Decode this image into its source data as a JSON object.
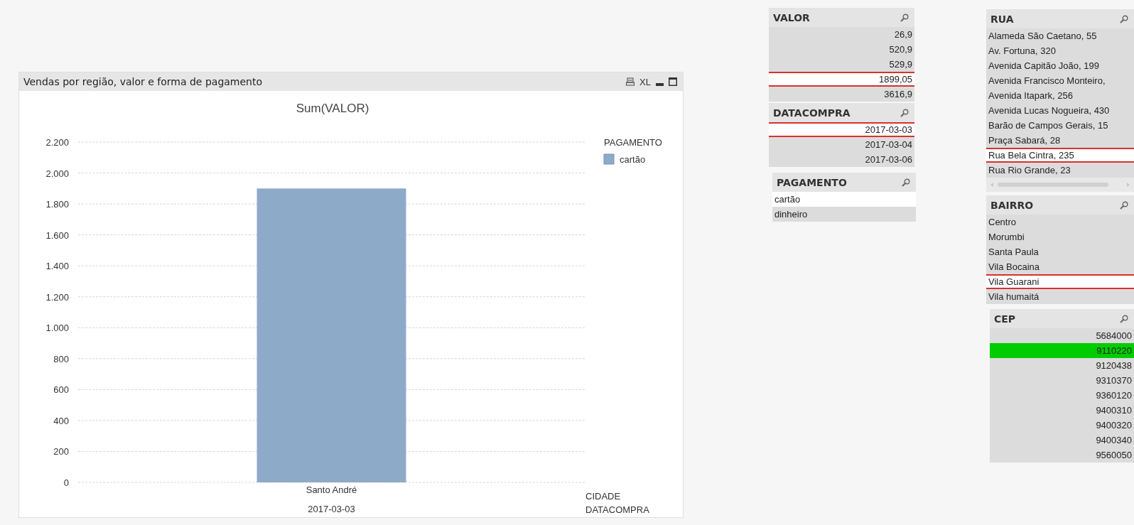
{
  "chart_panel": {
    "title": "Vendas por região, valor e forma de pagamento",
    "xl_label": "XL",
    "chart_data": {
      "type": "bar",
      "title": "Sum(VALOR)",
      "xlabel": "CIDADE",
      "categories": [
        "Santo André"
      ],
      "series": [
        {
          "name": "cartão",
          "color": "#8eaac9",
          "values": [
            1900
          ]
        }
      ],
      "grid": true,
      "ylim": [
        0,
        2200
      ],
      "yticks": [
        {
          "value": 0,
          "label": "0"
        },
        {
          "value": 200,
          "label": "200"
        },
        {
          "value": 400,
          "label": "400"
        },
        {
          "value": 600,
          "label": "600"
        },
        {
          "value": 800,
          "label": "800"
        },
        {
          "value": 1000,
          "label": "1.000"
        },
        {
          "value": 1200,
          "label": "1.200"
        },
        {
          "value": 1400,
          "label": "1.400"
        },
        {
          "value": 1600,
          "label": "1.600"
        },
        {
          "value": 1800,
          "label": "1.800"
        },
        {
          "value": 2000,
          "label": "2.000"
        },
        {
          "value": 2200,
          "label": "2.200"
        }
      ]
    },
    "legend_title": "PAGAMENTO",
    "second_dimension": {
      "label": "DATACOMPRA",
      "values": [
        "2017-03-03"
      ]
    }
  },
  "listboxes": [
    {
      "title": "VALOR",
      "kind": "numeric",
      "items": [
        {
          "text": "26,9",
          "selected": false,
          "possible": false,
          "outlined": false
        },
        {
          "text": "520,9",
          "selected": false,
          "possible": false,
          "outlined": false
        },
        {
          "text": "529,9",
          "selected": false,
          "possible": false,
          "outlined": false
        },
        {
          "text": "1899,05",
          "selected": false,
          "possible": true,
          "outlined": true
        },
        {
          "text": "3616,9",
          "selected": false,
          "possible": false,
          "outlined": false
        }
      ]
    },
    {
      "title": "DATACOMPRA",
      "kind": "numeric",
      "items": [
        {
          "text": "2017-03-03",
          "selected": false,
          "possible": true,
          "outlined": true
        },
        {
          "text": "2017-03-04",
          "selected": false,
          "possible": false,
          "outlined": false
        },
        {
          "text": "2017-03-06",
          "selected": false,
          "possible": false,
          "outlined": false
        }
      ]
    },
    {
      "title": "PAGAMENTO",
      "kind": "text",
      "items": [
        {
          "text": "cartão",
          "selected": false,
          "possible": true,
          "outlined": false
        },
        {
          "text": "dinheiro",
          "selected": false,
          "possible": false,
          "outlined": false
        }
      ]
    },
    {
      "title": "RUA",
      "kind": "text",
      "has_scrollbar": true,
      "items": [
        {
          "text": "Alameda São Caetano, 55",
          "selected": false,
          "possible": false,
          "outlined": false
        },
        {
          "text": "Av. Fortuna, 320",
          "selected": false,
          "possible": false,
          "outlined": false
        },
        {
          "text": "Avenida Capitão João, 199",
          "selected": false,
          "possible": false,
          "outlined": false
        },
        {
          "text": "Avenida Francisco Monteiro,",
          "selected": false,
          "possible": false,
          "outlined": false
        },
        {
          "text": "Avenida Itapark, 256",
          "selected": false,
          "possible": false,
          "outlined": false
        },
        {
          "text": "Avenida Lucas Nogueira, 430",
          "selected": false,
          "possible": false,
          "outlined": false
        },
        {
          "text": "Barão de Campos Gerais, 15",
          "selected": false,
          "possible": false,
          "outlined": false
        },
        {
          "text": "Praça Sabará, 28",
          "selected": false,
          "possible": false,
          "outlined": false
        },
        {
          "text": "Rua Bela Cintra, 235",
          "selected": false,
          "possible": true,
          "outlined": true
        },
        {
          "text": "Rua Rio Grande, 23",
          "selected": false,
          "possible": false,
          "outlined": false
        }
      ]
    },
    {
      "title": "BAIRRO",
      "kind": "text",
      "items": [
        {
          "text": "Centro",
          "selected": false,
          "possible": false,
          "outlined": false
        },
        {
          "text": "Morumbi",
          "selected": false,
          "possible": false,
          "outlined": false
        },
        {
          "text": "Santa Paula",
          "selected": false,
          "possible": false,
          "outlined": false
        },
        {
          "text": "Vila Bocaina",
          "selected": false,
          "possible": false,
          "outlined": false
        },
        {
          "text": "Vila Guarani",
          "selected": false,
          "possible": true,
          "outlined": true
        },
        {
          "text": "Vila humaitá",
          "selected": false,
          "possible": false,
          "outlined": false
        }
      ]
    },
    {
      "title": "CEP",
      "kind": "numeric",
      "items": [
        {
          "text": "5684000",
          "selected": false,
          "possible": false,
          "outlined": false
        },
        {
          "text": "9110220",
          "selected": true,
          "possible": false,
          "outlined": false
        },
        {
          "text": "9120438",
          "selected": false,
          "possible": false,
          "outlined": false
        },
        {
          "text": "9310370",
          "selected": false,
          "possible": false,
          "outlined": false
        },
        {
          "text": "9360120",
          "selected": false,
          "possible": false,
          "outlined": false
        },
        {
          "text": "9400310",
          "selected": false,
          "possible": false,
          "outlined": false
        },
        {
          "text": "9400320",
          "selected": false,
          "possible": false,
          "outlined": false
        },
        {
          "text": "9400340",
          "selected": false,
          "possible": false,
          "outlined": false
        },
        {
          "text": "9560050",
          "selected": false,
          "possible": false,
          "outlined": false
        }
      ]
    }
  ]
}
